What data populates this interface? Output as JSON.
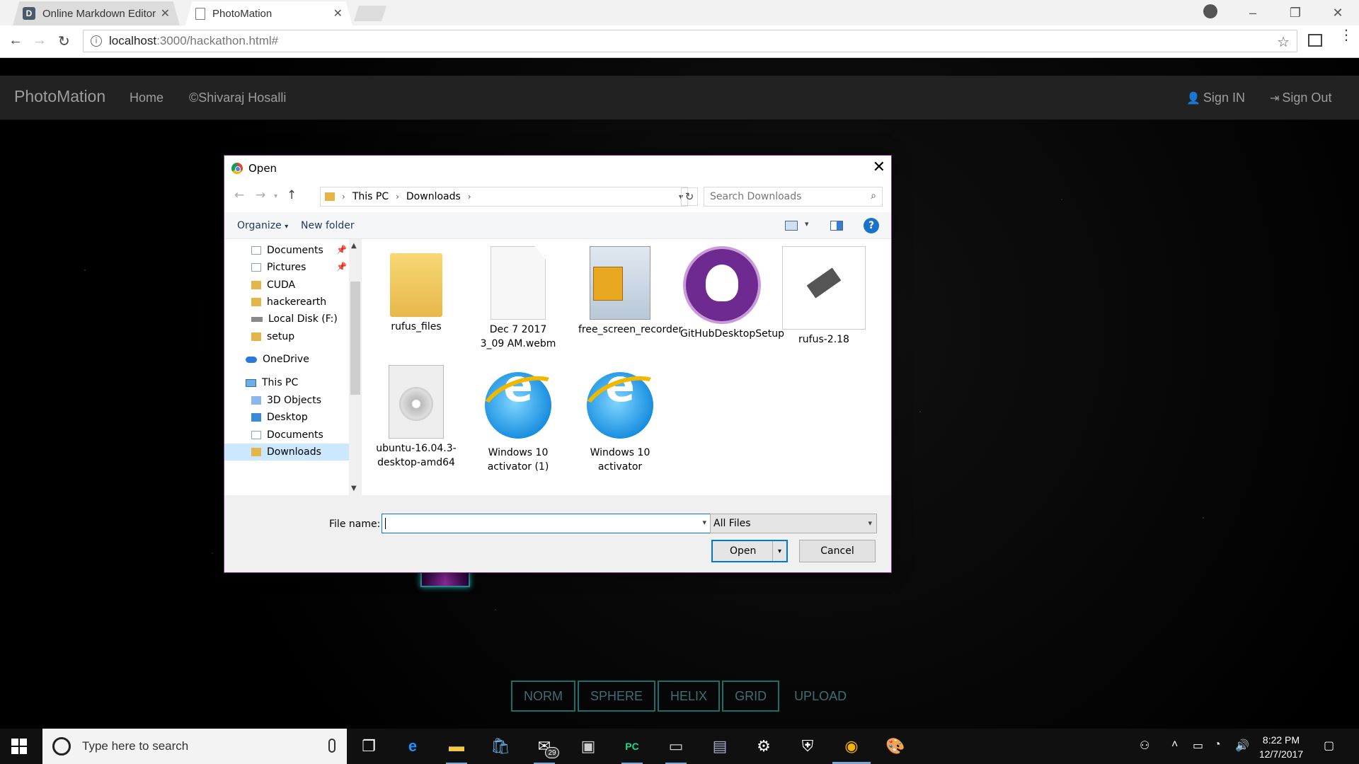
{
  "browser": {
    "tabs": [
      {
        "title": "Online Markdown Editor",
        "favicon": "D"
      },
      {
        "title": "PhotoMation"
      }
    ],
    "address": {
      "host": "localhost",
      "path": ":3000/hackathon.html#"
    }
  },
  "site": {
    "brand": "PhotoMation",
    "nav": {
      "home": "Home",
      "author": "©Shivaraj Hosalli",
      "sign_in": "Sign IN",
      "sign_out": "Sign Out"
    },
    "buttons": [
      "NORM",
      "SPHERE",
      "HELIX",
      "GRID",
      "UPLOAD"
    ]
  },
  "dialog": {
    "title": "Open",
    "breadcrumb": [
      "This PC",
      "Downloads"
    ],
    "search_placeholder": "Search Downloads",
    "organize": "Organize",
    "new_folder": "New folder",
    "nav_items": [
      {
        "label": "Documents",
        "pinned": true,
        "icon": "doc"
      },
      {
        "label": "Pictures",
        "pinned": true,
        "icon": "doc"
      },
      {
        "label": "CUDA",
        "icon": "folder"
      },
      {
        "label": "hackerearth",
        "icon": "folder"
      },
      {
        "label": "Local Disk (F:)",
        "icon": "drive"
      },
      {
        "label": "setup",
        "icon": "folder"
      },
      {
        "label": "OneDrive",
        "icon": "cloud"
      },
      {
        "label": "This PC",
        "icon": "pc"
      },
      {
        "label": "3D Objects",
        "icon": "cube"
      },
      {
        "label": "Desktop",
        "icon": "desk"
      },
      {
        "label": "Documents",
        "icon": "doc"
      },
      {
        "label": "Downloads",
        "icon": "folder",
        "selected": true
      }
    ],
    "files": [
      {
        "name": "rufus_files",
        "icon": "folder"
      },
      {
        "name": "Dec 7 2017 3_09 AM.webm",
        "icon": "document"
      },
      {
        "name": "free_screen_recorder",
        "icon": "archive"
      },
      {
        "name": "GitHubDesktopSetup",
        "icon": "github"
      },
      {
        "name": "rufus-2.18",
        "icon": "usb-drive"
      },
      {
        "name": "ubuntu-16.04.3-desktop-amd64",
        "icon": "disc-image"
      },
      {
        "name": "Windows 10 activator (1)",
        "icon": "internet-explorer"
      },
      {
        "name": "Windows 10 activator",
        "icon": "internet-explorer"
      }
    ],
    "file_name_label": "File name:",
    "file_name_value": "",
    "filter": "All Files",
    "open_label": "Open",
    "cancel_label": "Cancel"
  },
  "taskbar": {
    "search_placeholder": "Type here to search",
    "mail_badge": "29",
    "time": "8:22 PM",
    "date": "12/7/2017"
  }
}
